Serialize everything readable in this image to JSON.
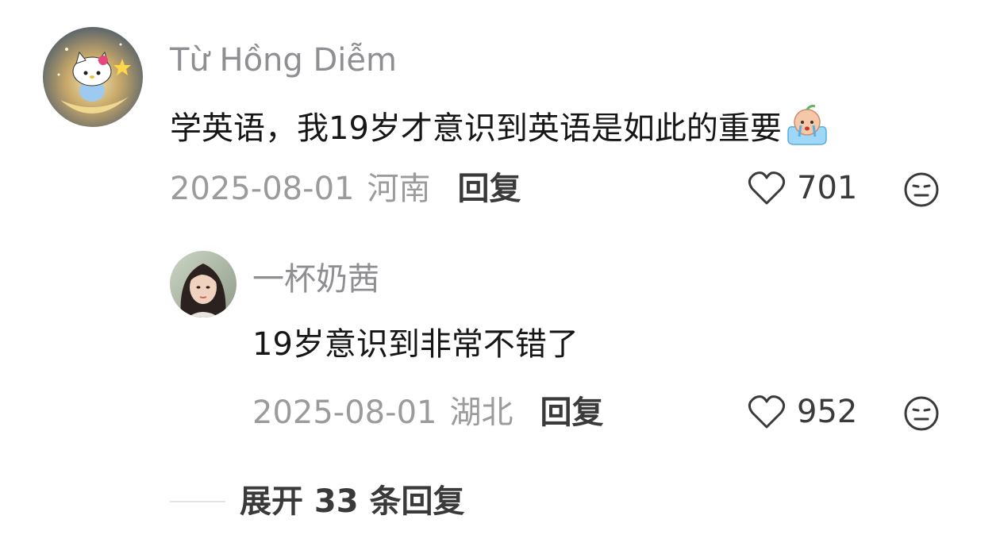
{
  "comment": {
    "author": "Từ Hồng Diễm",
    "text": "学英语，我19岁才意识到英语是如此的重要",
    "emoji": "crying-face-emoji",
    "date": "2025-08-01",
    "location": "河南",
    "reply_label": "回复",
    "likes": "701"
  },
  "reply": {
    "author": "一杯奶茜",
    "text": "19岁意识到非常不错了",
    "date": "2025-08-01",
    "location": "湖北",
    "reply_label": "回复",
    "likes": "952"
  },
  "expand": {
    "label": "展开 33 条回复"
  },
  "icons": {
    "like": "heart-outline-icon",
    "dislike": "meh-face-icon"
  },
  "colors": {
    "name": "#8e8e93",
    "text": "#161616",
    "meta": "#9b9b9b",
    "action": "#3a3a3a"
  }
}
